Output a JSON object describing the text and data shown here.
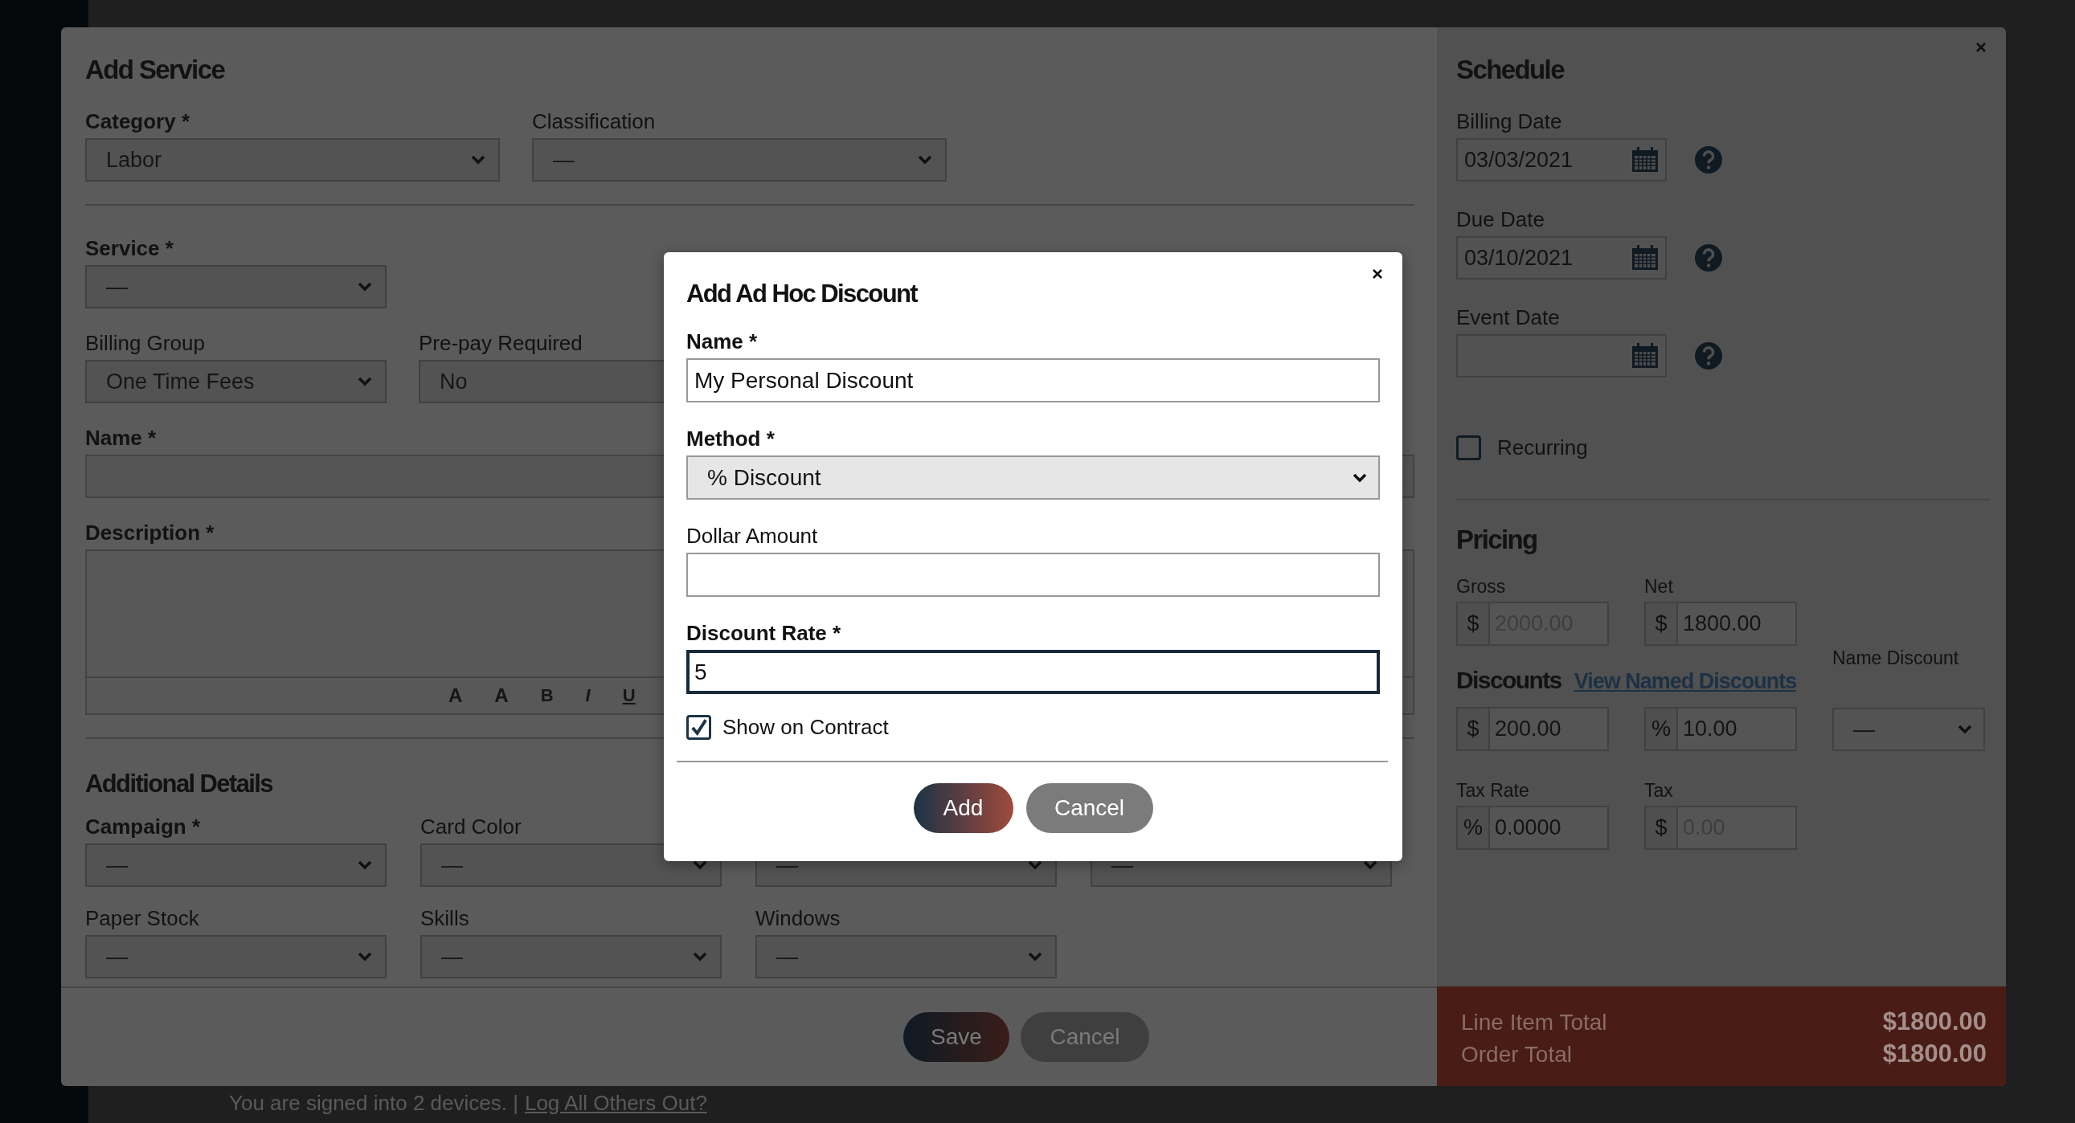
{
  "background_page": {
    "footer_text": "You are signed into 2 devices. |",
    "footer_link": "Log All Others Out?"
  },
  "add_service": {
    "title": "Add Service",
    "category": {
      "label": "Category *",
      "required": true,
      "value": "Labor"
    },
    "classification": {
      "label": "Classification",
      "required": false,
      "value": "—"
    },
    "service": {
      "label": "Service *",
      "required": true,
      "value": "—"
    },
    "billing_group": {
      "label": "Billing Group",
      "required": false,
      "value": "One Time Fees"
    },
    "prepay": {
      "label": "Pre-pay Required",
      "required": false,
      "value": "No"
    },
    "name": {
      "label": "Name *",
      "required": true
    },
    "description": {
      "label": "Description *",
      "required": true,
      "toolbar": [
        {
          "kind": "size-down",
          "glyph": "A"
        },
        {
          "kind": "size-up",
          "glyph": "A"
        },
        {
          "kind": "bold",
          "glyph": "B"
        },
        {
          "kind": "italic",
          "glyph": "I"
        },
        {
          "kind": "underline",
          "glyph": "U"
        }
      ]
    },
    "additional_title": "Additional Details",
    "additional_fields": [
      {
        "label": "Campaign *",
        "required": true,
        "value": "—"
      },
      {
        "label": "Card Color",
        "required": false,
        "value": "—"
      },
      {
        "value": "—"
      },
      {
        "value": "—"
      },
      {
        "label": "Paper Stock",
        "required": false,
        "value": "—"
      },
      {
        "label": "Skills",
        "required": false,
        "value": "—"
      },
      {
        "label": "Windows",
        "required": false,
        "value": "—"
      }
    ],
    "buttons": [
      {
        "label": "Save",
        "kind": "primary"
      },
      {
        "label": "Cancel",
        "kind": "secondary"
      }
    ]
  },
  "schedule": {
    "title": "Schedule",
    "dates": [
      {
        "label": "Billing Date",
        "value": "03/03/2021"
      },
      {
        "label": "Due Date",
        "value": "03/10/2021"
      },
      {
        "label": "Event Date"
      }
    ],
    "recurring": {
      "label": "Recurring",
      "checked": false
    }
  },
  "pricing": {
    "title": "Pricing",
    "gross": {
      "label": "Gross",
      "prefix": "$",
      "value": "2000.00",
      "disabled": true
    },
    "net": {
      "label": "Net",
      "prefix": "$",
      "value": "1800.00",
      "disabled": false
    },
    "discounts_title": "Discounts",
    "named_discounts_link": "View Named Discounts",
    "name_discount": {
      "label": "Name Discount",
      "value": "—"
    },
    "discount_amount": {
      "prefix": "$",
      "value": "200.00",
      "disabled": false
    },
    "discount_percent": {
      "prefix": "%",
      "value": "10.00",
      "disabled": false
    },
    "tax_rate": {
      "label": "Tax Rate",
      "prefix": "%",
      "value": "0.0000",
      "disabled": false
    },
    "tax": {
      "label": "Tax",
      "prefix": "$",
      "value": "0.00",
      "disabled": true
    }
  },
  "totals": [
    {
      "label": "Line Item Total",
      "value": "$1800.00"
    },
    {
      "label": "Order Total",
      "value": "$1800.00"
    }
  ],
  "dialog": {
    "title": "Add Ad Hoc Discount",
    "fields": [
      {
        "kind": "input",
        "label": "Name *",
        "required": true,
        "value": "My Personal Discount",
        "focused": false
      },
      {
        "kind": "select",
        "label": "Method *",
        "required": true,
        "value": "% Discount"
      },
      {
        "kind": "input",
        "label": "Dollar Amount",
        "required": false,
        "focused": false
      },
      {
        "kind": "input",
        "label": "Discount Rate *",
        "required": true,
        "value": "5",
        "focused": true
      }
    ],
    "show_on_contract": {
      "label": "Show on Contract",
      "checked": true
    },
    "buttons": [
      {
        "label": "Add",
        "kind": "primary"
      },
      {
        "label": "Cancel",
        "kind": "secondary"
      }
    ]
  }
}
